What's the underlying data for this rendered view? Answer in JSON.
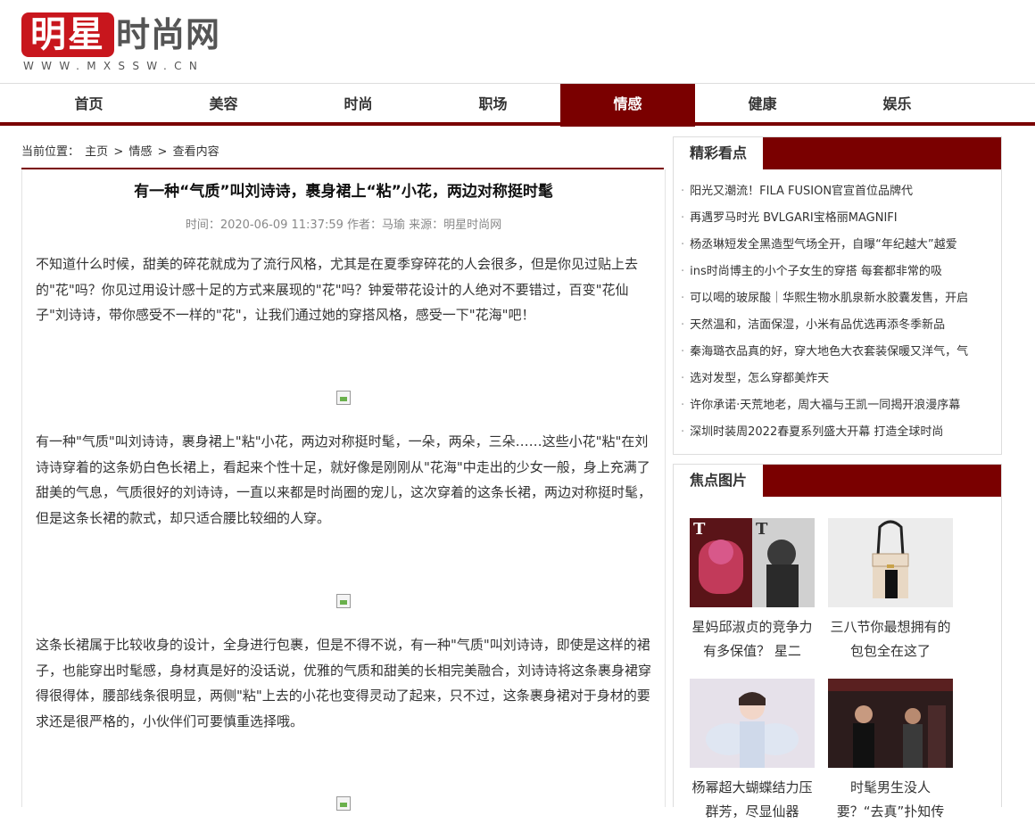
{
  "brand": {
    "logo_mark": "明星",
    "logo_rest": "时尚网",
    "logo_url": "WWW.MXSSW.CN",
    "accent": "#7a0000",
    "logo_red": "#c8161d"
  },
  "nav": [
    {
      "label": "首页"
    },
    {
      "label": "美容"
    },
    {
      "label": "时尚"
    },
    {
      "label": "职场"
    },
    {
      "label": "情感",
      "active": true
    },
    {
      "label": "健康"
    },
    {
      "label": "娱乐"
    }
  ],
  "breadcrumb": {
    "prefix": "当前位置：",
    "home": "主页",
    "sep1": ">",
    "category": "情感",
    "sep2": ">",
    "current": "查看内容"
  },
  "article": {
    "title": "有一种“气质”叫刘诗诗，裹身裙上“粘”小花，两边对称挺时髦",
    "meta": "时间：2020-06-09 11:37:59 作者：马瑜 来源：明星时尚网",
    "paragraphs": [
      "不知道什么时候，甜美的碎花就成为了流行风格，尤其是在夏季穿碎花的人会很多，但是你见过贴上去的\"花\"吗？你见过用设计感十足的方式来展现的\"花\"吗？钟爱带花设计的人绝对不要错过，百变\"花仙子\"刘诗诗，带你感受不一样的\"花\"，让我们通过她的穿搭风格，感受一下\"花海\"吧！",
      "有一种\"气质\"叫刘诗诗，裹身裙上\"粘\"小花，两边对称挺时髦，一朵，两朵，三朵……这些小花\"粘\"在刘诗诗穿着的这条奶白色长裙上，看起来个性十足，就好像是刚刚从\"花海\"中走出的少女一般，身上充满了甜美的气息，气质很好的刘诗诗，一直以来都是时尚圈的宠儿，这次穿着的这条长裙，两边对称挺时髦，但是这条长裙的款式，却只适合腰比较细的人穿。",
      "这条长裙属于比较收身的设计，全身进行包裹，但是不得不说，有一种\"气质\"叫刘诗诗，即使是这样的裙子，也能穿出时髦感，身材真是好的没话说，优雅的气质和甜美的长相完美融合，刘诗诗将这条裹身裙穿得很得体，腰部线条很明显，两侧\"粘\"上去的小花也变得灵动了起来，只不过，这条裹身裙对于身材的要求还是很严格的，小伙伴们可要慎重选择哦。"
    ]
  },
  "sidebar": {
    "highlights": {
      "title": "精彩看点",
      "items": [
        "阳光又潮流！FILA FUSION官宣首位品牌代",
        "再遇罗马时光 BVLGARI宝格丽MAGNIFI",
        "杨丞琳短发全黑造型气场全开，自曝“年纪越大”越爱",
        "ins时尚博主的小个子女生的穿搭 每套都非常的吸",
        "可以喝的玻尿酸｜华熙生物水肌泉新水胶囊发售，开启",
        "天然温和，洁面保湿，小米有品优选再添冬季新品",
        "秦海璐衣品真的好，穿大地色大衣套装保暖又洋气，气",
        "选对发型，怎么穿都美炸天",
        "许你承诺·天荒地老，周大福与王凯一同揭开浪漫序幕",
        "深圳时装周2022春夏系列盛大开幕 打造全球时尚"
      ]
    },
    "focus": {
      "title": "焦点图片",
      "cards": [
        {
          "caption": "星妈邱淑贞的竞争力有多保值？ 星二"
        },
        {
          "caption": "三八节你最想拥有的包包全在这了"
        },
        {
          "caption": "杨幂超大蝴蝶结力压群芳，尽显仙器"
        },
        {
          "caption": "时髦男生没人要？“去真”扑知传"
        }
      ]
    }
  }
}
